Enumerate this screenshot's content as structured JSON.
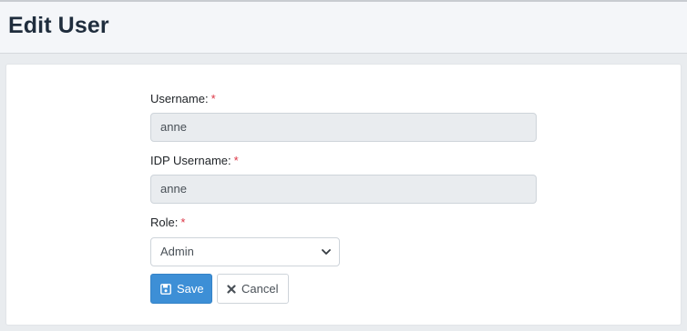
{
  "header": {
    "title": "Edit User"
  },
  "form": {
    "username": {
      "label": "Username:",
      "required_mark": "*",
      "value": "anne"
    },
    "idp_username": {
      "label": "IDP Username:",
      "required_mark": "*",
      "value": "anne"
    },
    "role": {
      "label": "Role:",
      "required_mark": "*",
      "selected": "Admin"
    }
  },
  "actions": {
    "save_label": "Save",
    "cancel_label": "Cancel"
  },
  "icons": {
    "save": "floppy-disk-icon",
    "cancel": "times-icon",
    "select_caret": "chevron-down-icon"
  },
  "colors": {
    "primary": "#3d8fd6",
    "required": "#dc3545",
    "readonly_bg": "#e9ecef"
  }
}
